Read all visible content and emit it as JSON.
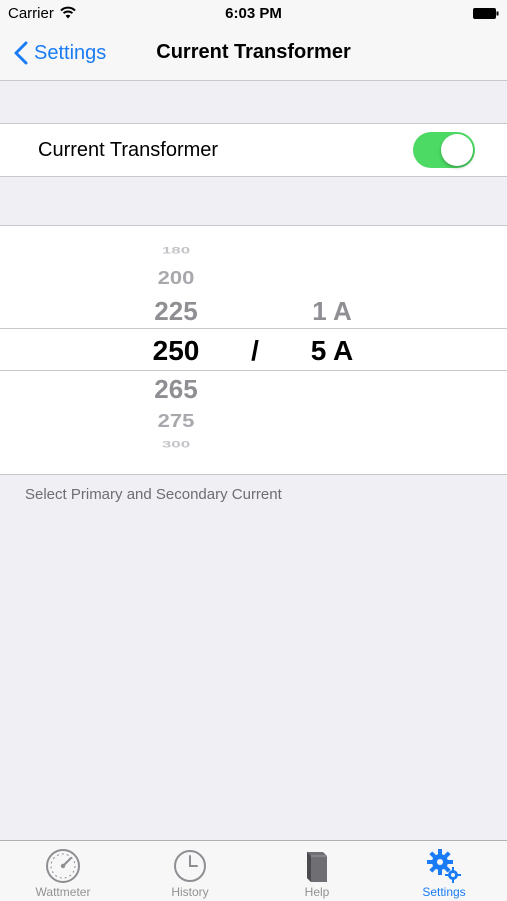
{
  "status_bar": {
    "carrier": "Carrier",
    "time": "6:03 PM"
  },
  "nav": {
    "back_label": "Settings",
    "title": "Current Transformer"
  },
  "toggle": {
    "label": "Current Transformer",
    "on": true
  },
  "picker": {
    "primary_values": [
      "180",
      "200",
      "225",
      "250",
      "265",
      "275",
      "300"
    ],
    "primary_selected": "250",
    "separator": "/",
    "secondary_values": [
      "1 A",
      "5 A"
    ],
    "secondary_selected": "5 A"
  },
  "footer_note": "Select Primary and Secondary Current",
  "tabs": [
    {
      "label": "Wattmeter",
      "icon": "gauge-icon",
      "active": false
    },
    {
      "label": "History",
      "icon": "clock-icon",
      "active": false
    },
    {
      "label": "Help",
      "icon": "book-icon",
      "active": false
    },
    {
      "label": "Settings",
      "icon": "gears-icon",
      "active": true
    }
  ],
  "colors": {
    "accent": "#1a7cf5",
    "switch_on": "#4cd964",
    "background": "#efeff4"
  }
}
